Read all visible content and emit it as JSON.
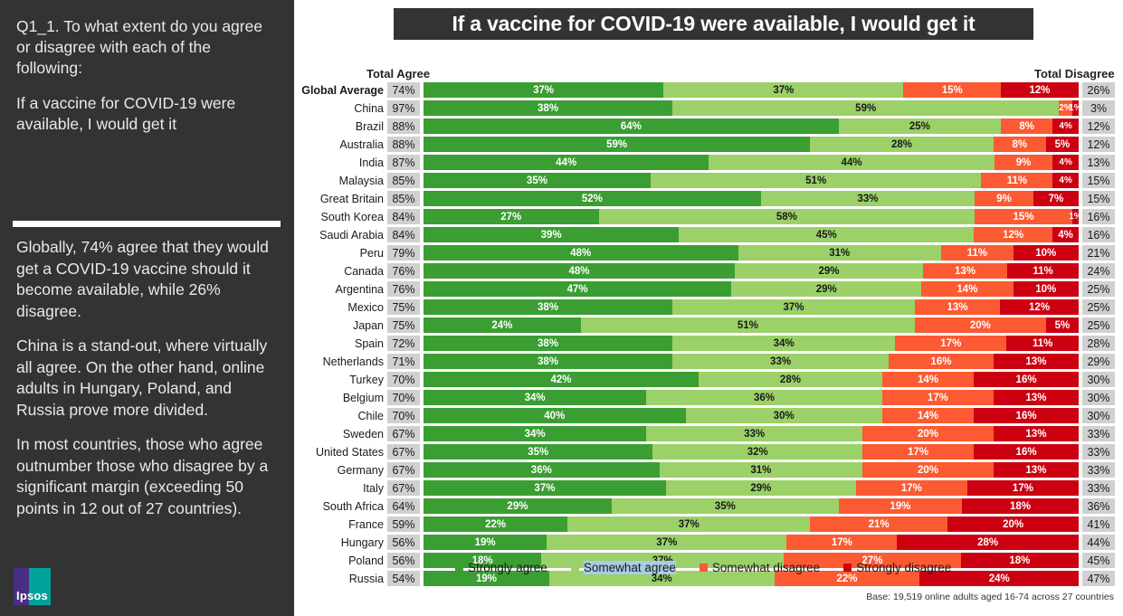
{
  "left_panel": {
    "question": [
      "Q1_1. To what extent do you agree or disagree with each of the following:",
      "If a vaccine for COVID-19 were available, I would get it"
    ],
    "insights": [
      "Globally, 74% agree that they would get a COVID-19 vaccine should it become available, while 26% disagree.",
      "China is a stand-out, where virtually all agree. On the other hand, online adults in Hungary, Poland, and Russia prove more divided.",
      "In most countries, those who agree outnumber those who disagree by a significant margin (exceeding 50 points in 12 out of 27 countries)."
    ],
    "logo_text": "Ipsos"
  },
  "chart_data": {
    "type": "bar",
    "title": "If a vaccine for COVID-19 were available, I would get it",
    "subtype": "stacked-horizontal-100",
    "xlabel": "",
    "ylabel": "",
    "xlim": [
      0,
      100
    ],
    "grid": false,
    "legend_position": "bottom",
    "column_headers": {
      "total_agree": "Total Agree",
      "total_disagree": "Total Disagree"
    },
    "legend": [
      {
        "name": "Strongly agree",
        "color": "#3a9e32",
        "selected": false
      },
      {
        "name": "Somewhat agree",
        "color": "#9bd168",
        "selected": true
      },
      {
        "name": "Somewhat disagree",
        "color": "#fc5a32",
        "selected": false
      },
      {
        "name": "Strongly disagree",
        "color": "#cc0011",
        "selected": false
      }
    ],
    "series": [
      {
        "name": "Strongly agree",
        "key": "strongly_agree",
        "color": "#3a9e32"
      },
      {
        "name": "Somewhat agree",
        "key": "somewhat_agree",
        "color": "#9bd168"
      },
      {
        "name": "Somewhat disagree",
        "key": "somewhat_disagree",
        "color": "#fc5a32"
      },
      {
        "name": "Strongly disagree",
        "key": "strongly_disagree",
        "color": "#cc0011"
      }
    ],
    "categories": [
      "Global Average",
      "China",
      "Brazil",
      "Australia",
      "India",
      "Malaysia",
      "Great Britain",
      "South Korea",
      "Saudi Arabia",
      "Peru",
      "Canada",
      "Argentina",
      "Mexico",
      "Japan",
      "Spain",
      "Netherlands",
      "Turkey",
      "Belgium",
      "Chile",
      "Sweden",
      "United States",
      "Germany",
      "Italy",
      "South Africa",
      "France",
      "Hungary",
      "Poland",
      "Russia"
    ],
    "rows": [
      {
        "country": "Global Average",
        "total_agree": "74%",
        "total_disagree": "26%",
        "strongly_agree": 37,
        "somewhat_agree": 37,
        "somewhat_disagree": 15,
        "strongly_disagree": 12,
        "labels": [
          "37%",
          "37%",
          "15%",
          "12%"
        ],
        "is_global": true
      },
      {
        "country": "China",
        "total_agree": "97%",
        "total_disagree": "3%",
        "strongly_agree": 38,
        "somewhat_agree": 59,
        "somewhat_disagree": 2,
        "strongly_disagree": 1,
        "labels": [
          "38%",
          "59%",
          "2%",
          "1%"
        ],
        "is_global": false
      },
      {
        "country": "Brazil",
        "total_agree": "88%",
        "total_disagree": "12%",
        "strongly_agree": 64,
        "somewhat_agree": 25,
        "somewhat_disagree": 8,
        "strongly_disagree": 4,
        "labels": [
          "64%",
          "25%",
          "8%",
          "4%"
        ],
        "is_global": false
      },
      {
        "country": "Australia",
        "total_agree": "88%",
        "total_disagree": "12%",
        "strongly_agree": 59,
        "somewhat_agree": 28,
        "somewhat_disagree": 8,
        "strongly_disagree": 5,
        "labels": [
          "59%",
          "28%",
          "8%",
          "5%"
        ],
        "is_global": false
      },
      {
        "country": "India",
        "total_agree": "87%",
        "total_disagree": "13%",
        "strongly_agree": 44,
        "somewhat_agree": 44,
        "somewhat_disagree": 9,
        "strongly_disagree": 4,
        "labels": [
          "44%",
          "44%",
          "9%",
          "4%"
        ],
        "is_global": false
      },
      {
        "country": "Malaysia",
        "total_agree": "85%",
        "total_disagree": "15%",
        "strongly_agree": 35,
        "somewhat_agree": 51,
        "somewhat_disagree": 11,
        "strongly_disagree": 4,
        "labels": [
          "35%",
          "51%",
          "11%",
          "4%"
        ],
        "is_global": false
      },
      {
        "country": "Great Britain",
        "total_agree": "85%",
        "total_disagree": "15%",
        "strongly_agree": 52,
        "somewhat_agree": 33,
        "somewhat_disagree": 9,
        "strongly_disagree": 7,
        "labels": [
          "52%",
          "33%",
          "9%",
          "7%"
        ],
        "is_global": false
      },
      {
        "country": "South Korea",
        "total_agree": "84%",
        "total_disagree": "16%",
        "strongly_agree": 27,
        "somewhat_agree": 58,
        "somewhat_disagree": 15,
        "strongly_disagree": 1,
        "labels": [
          "27%",
          "58%",
          "15%",
          "1%"
        ],
        "is_global": false
      },
      {
        "country": "Saudi Arabia",
        "total_agree": "84%",
        "total_disagree": "16%",
        "strongly_agree": 39,
        "somewhat_agree": 45,
        "somewhat_disagree": 12,
        "strongly_disagree": 4,
        "labels": [
          "39%",
          "45%",
          "12%",
          "4%"
        ],
        "is_global": false
      },
      {
        "country": "Peru",
        "total_agree": "79%",
        "total_disagree": "21%",
        "strongly_agree": 48,
        "somewhat_agree": 31,
        "somewhat_disagree": 11,
        "strongly_disagree": 10,
        "labels": [
          "48%",
          "31%",
          "11%",
          "10%"
        ],
        "is_global": false
      },
      {
        "country": "Canada",
        "total_agree": "76%",
        "total_disagree": "24%",
        "strongly_agree": 48,
        "somewhat_agree": 29,
        "somewhat_disagree": 13,
        "strongly_disagree": 11,
        "labels": [
          "48%",
          "29%",
          "13%",
          "11%"
        ],
        "is_global": false
      },
      {
        "country": "Argentina",
        "total_agree": "76%",
        "total_disagree": "25%",
        "strongly_agree": 47,
        "somewhat_agree": 29,
        "somewhat_disagree": 14,
        "strongly_disagree": 10,
        "labels": [
          "47%",
          "29%",
          "14%",
          "10%"
        ],
        "is_global": false
      },
      {
        "country": "Mexico",
        "total_agree": "75%",
        "total_disagree": "25%",
        "strongly_agree": 38,
        "somewhat_agree": 37,
        "somewhat_disagree": 13,
        "strongly_disagree": 12,
        "labels": [
          "38%",
          "37%",
          "13%",
          "12%"
        ],
        "is_global": false
      },
      {
        "country": "Japan",
        "total_agree": "75%",
        "total_disagree": "25%",
        "strongly_agree": 24,
        "somewhat_agree": 51,
        "somewhat_disagree": 20,
        "strongly_disagree": 5,
        "labels": [
          "24%",
          "51%",
          "20%",
          "5%"
        ],
        "is_global": false
      },
      {
        "country": "Spain",
        "total_agree": "72%",
        "total_disagree": "28%",
        "strongly_agree": 38,
        "somewhat_agree": 34,
        "somewhat_disagree": 17,
        "strongly_disagree": 11,
        "labels": [
          "38%",
          "34%",
          "17%",
          "11%"
        ],
        "is_global": false
      },
      {
        "country": "Netherlands",
        "total_agree": "71%",
        "total_disagree": "29%",
        "strongly_agree": 38,
        "somewhat_agree": 33,
        "somewhat_disagree": 16,
        "strongly_disagree": 13,
        "labels": [
          "38%",
          "33%",
          "16%",
          "13%"
        ],
        "is_global": false
      },
      {
        "country": "Turkey",
        "total_agree": "70%",
        "total_disagree": "30%",
        "strongly_agree": 42,
        "somewhat_agree": 28,
        "somewhat_disagree": 14,
        "strongly_disagree": 16,
        "labels": [
          "42%",
          "28%",
          "14%",
          "16%"
        ],
        "is_global": false
      },
      {
        "country": "Belgium",
        "total_agree": "70%",
        "total_disagree": "30%",
        "strongly_agree": 34,
        "somewhat_agree": 36,
        "somewhat_disagree": 17,
        "strongly_disagree": 13,
        "labels": [
          "34%",
          "36%",
          "17%",
          "13%"
        ],
        "is_global": false
      },
      {
        "country": "Chile",
        "total_agree": "70%",
        "total_disagree": "30%",
        "strongly_agree": 40,
        "somewhat_agree": 30,
        "somewhat_disagree": 14,
        "strongly_disagree": 16,
        "labels": [
          "40%",
          "30%",
          "14%",
          "16%"
        ],
        "is_global": false
      },
      {
        "country": "Sweden",
        "total_agree": "67%",
        "total_disagree": "33%",
        "strongly_agree": 34,
        "somewhat_agree": 33,
        "somewhat_disagree": 20,
        "strongly_disagree": 13,
        "labels": [
          "34%",
          "33%",
          "20%",
          "13%"
        ],
        "is_global": false
      },
      {
        "country": "United States",
        "total_agree": "67%",
        "total_disagree": "33%",
        "strongly_agree": 35,
        "somewhat_agree": 32,
        "somewhat_disagree": 17,
        "strongly_disagree": 16,
        "labels": [
          "35%",
          "32%",
          "17%",
          "16%"
        ],
        "is_global": false
      },
      {
        "country": "Germany",
        "total_agree": "67%",
        "total_disagree": "33%",
        "strongly_agree": 36,
        "somewhat_agree": 31,
        "somewhat_disagree": 20,
        "strongly_disagree": 13,
        "labels": [
          "36%",
          "31%",
          "20%",
          "13%"
        ],
        "is_global": false
      },
      {
        "country": "Italy",
        "total_agree": "67%",
        "total_disagree": "33%",
        "strongly_agree": 37,
        "somewhat_agree": 29,
        "somewhat_disagree": 17,
        "strongly_disagree": 17,
        "labels": [
          "37%",
          "29%",
          "17%",
          "17%"
        ],
        "is_global": false
      },
      {
        "country": "South Africa",
        "total_agree": "64%",
        "total_disagree": "36%",
        "strongly_agree": 29,
        "somewhat_agree": 35,
        "somewhat_disagree": 19,
        "strongly_disagree": 18,
        "labels": [
          "29%",
          "35%",
          "19%",
          "18%"
        ],
        "is_global": false
      },
      {
        "country": "France",
        "total_agree": "59%",
        "total_disagree": "41%",
        "strongly_agree": 22,
        "somewhat_agree": 37,
        "somewhat_disagree": 21,
        "strongly_disagree": 20,
        "labels": [
          "22%",
          "37%",
          "21%",
          "20%"
        ],
        "is_global": false
      },
      {
        "country": "Hungary",
        "total_agree": "56%",
        "total_disagree": "44%",
        "strongly_agree": 19,
        "somewhat_agree": 37,
        "somewhat_disagree": 17,
        "strongly_disagree": 28,
        "labels": [
          "19%",
          "37%",
          "17%",
          "28%"
        ],
        "is_global": false
      },
      {
        "country": "Poland",
        "total_agree": "56%",
        "total_disagree": "45%",
        "strongly_agree": 18,
        "somewhat_agree": 37,
        "somewhat_disagree": 27,
        "strongly_disagree": 18,
        "labels": [
          "18%",
          "37%",
          "27%",
          "18%"
        ],
        "is_global": false
      },
      {
        "country": "Russia",
        "total_agree": "54%",
        "total_disagree": "47%",
        "strongly_agree": 19,
        "somewhat_agree": 34,
        "somewhat_disagree": 22,
        "strongly_disagree": 24,
        "labels": [
          "19%",
          "34%",
          "22%",
          "24%"
        ],
        "is_global": false
      }
    ]
  },
  "footer": {
    "base_note": "Base: 19,519 online adults aged 16-74 across 27 countries"
  }
}
